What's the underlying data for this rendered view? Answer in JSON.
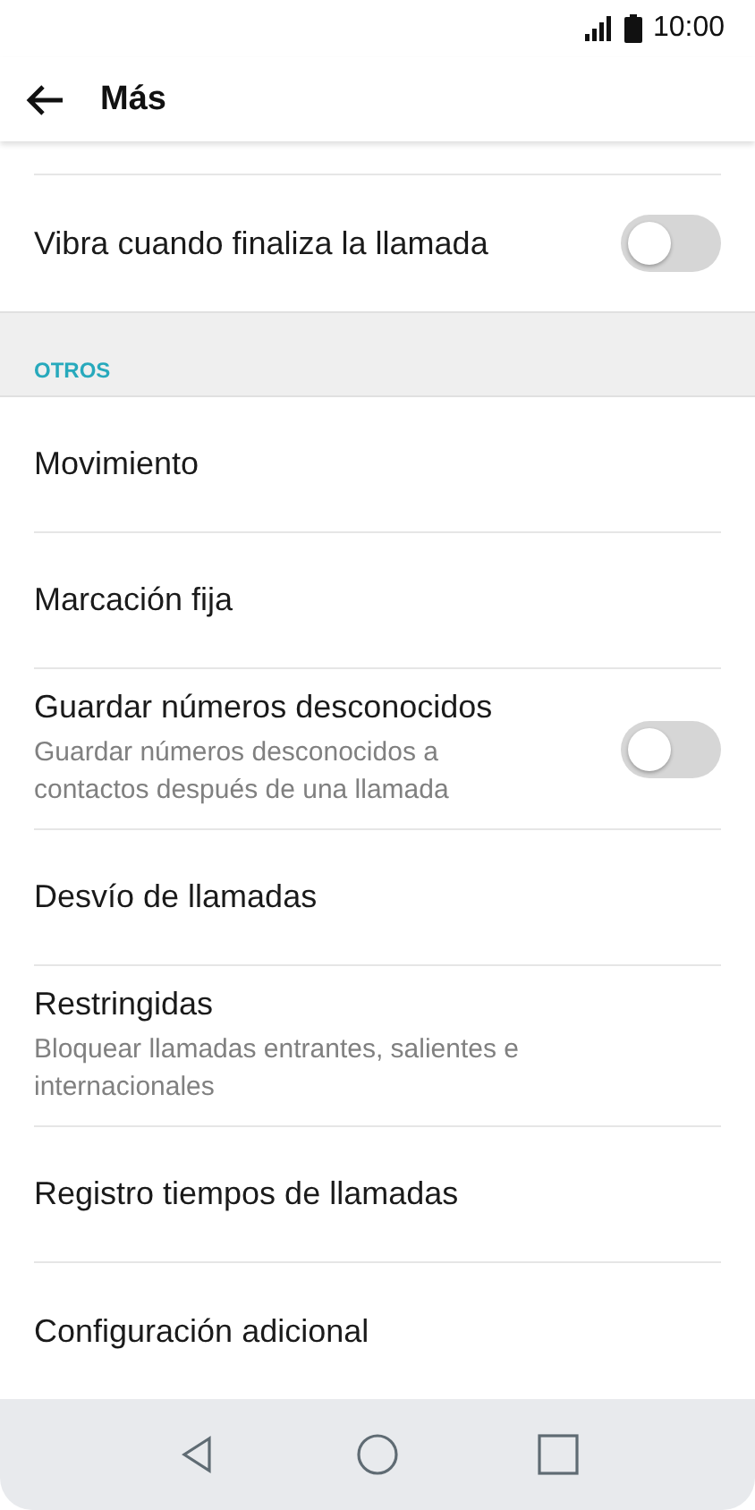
{
  "status_bar": {
    "time": "10:00"
  },
  "header": {
    "title": "Más"
  },
  "top_items": [
    {
      "kind": "toggle",
      "title": "Vibra cuando finaliza la llamada",
      "on": false
    }
  ],
  "section": {
    "title": "OTROS"
  },
  "items": [
    {
      "kind": "plain",
      "title": "Movimiento"
    },
    {
      "kind": "plain",
      "title": "Marcación fija"
    },
    {
      "kind": "toggle",
      "title": "Guardar números desconocidos",
      "subtitle": "Guardar números desconocidos a contactos después de una llamada",
      "on": false
    },
    {
      "kind": "plain",
      "title": "Desvío de llamadas"
    },
    {
      "kind": "plain",
      "title": "Restringidas",
      "subtitle": "Bloquear llamadas entrantes, salientes e internacionales"
    },
    {
      "kind": "plain",
      "title": "Registro tiempos de llamadas"
    },
    {
      "kind": "plain",
      "title": "Configuración adicional"
    }
  ]
}
